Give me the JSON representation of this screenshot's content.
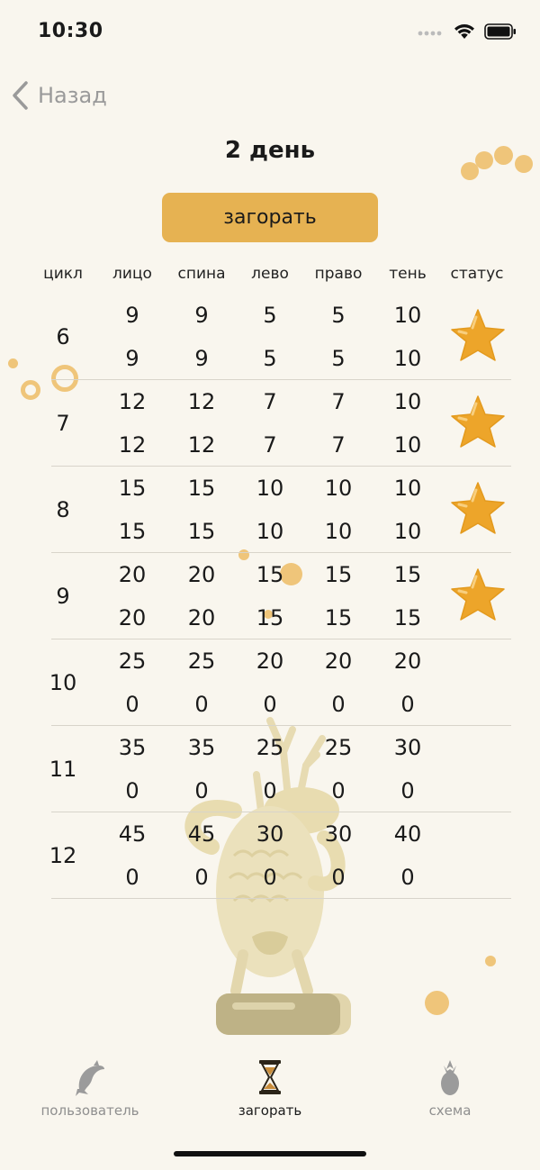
{
  "status_bar": {
    "time": "10:30"
  },
  "nav": {
    "back_label": "Назад"
  },
  "page": {
    "title": "2 день",
    "action_label": "загорать"
  },
  "table": {
    "headers": [
      "цикл",
      "лицо",
      "спина",
      "лево",
      "право",
      "тень",
      "статус"
    ],
    "rows": [
      {
        "cycle": "6",
        "top": [
          "9",
          "9",
          "5",
          "5",
          "10"
        ],
        "bottom": [
          "9",
          "9",
          "5",
          "5",
          "10"
        ],
        "status": "star"
      },
      {
        "cycle": "7",
        "top": [
          "12",
          "12",
          "7",
          "7",
          "10"
        ],
        "bottom": [
          "12",
          "12",
          "7",
          "7",
          "10"
        ],
        "status": "star"
      },
      {
        "cycle": "8",
        "top": [
          "15",
          "15",
          "10",
          "10",
          "10"
        ],
        "bottom": [
          "15",
          "15",
          "10",
          "10",
          "10"
        ],
        "status": "star"
      },
      {
        "cycle": "9",
        "top": [
          "20",
          "20",
          "15",
          "15",
          "15"
        ],
        "bottom": [
          "20",
          "20",
          "15",
          "15",
          "15"
        ],
        "status": "star"
      },
      {
        "cycle": "10",
        "top": [
          "25",
          "25",
          "20",
          "20",
          "20"
        ],
        "bottom": [
          "0",
          "0",
          "0",
          "0",
          "0"
        ],
        "status": ""
      },
      {
        "cycle": "11",
        "top": [
          "35",
          "35",
          "25",
          "25",
          "30"
        ],
        "bottom": [
          "0",
          "0",
          "0",
          "0",
          "0"
        ],
        "status": ""
      },
      {
        "cycle": "12",
        "top": [
          "45",
          "45",
          "30",
          "30",
          "40"
        ],
        "bottom": [
          "0",
          "0",
          "0",
          "0",
          "0"
        ],
        "status": ""
      }
    ]
  },
  "tabbar": {
    "tabs": [
      {
        "label": "пользователь",
        "icon": "dolphin-icon",
        "active": false
      },
      {
        "label": "загорать",
        "icon": "hourglass-icon",
        "active": true
      },
      {
        "label": "схема",
        "icon": "pineapple-icon",
        "active": false
      }
    ]
  },
  "colors": {
    "accent": "#e6b252",
    "star": "#eda52a",
    "background": "#f9f6ee",
    "mascot": "#e8dcb0"
  }
}
